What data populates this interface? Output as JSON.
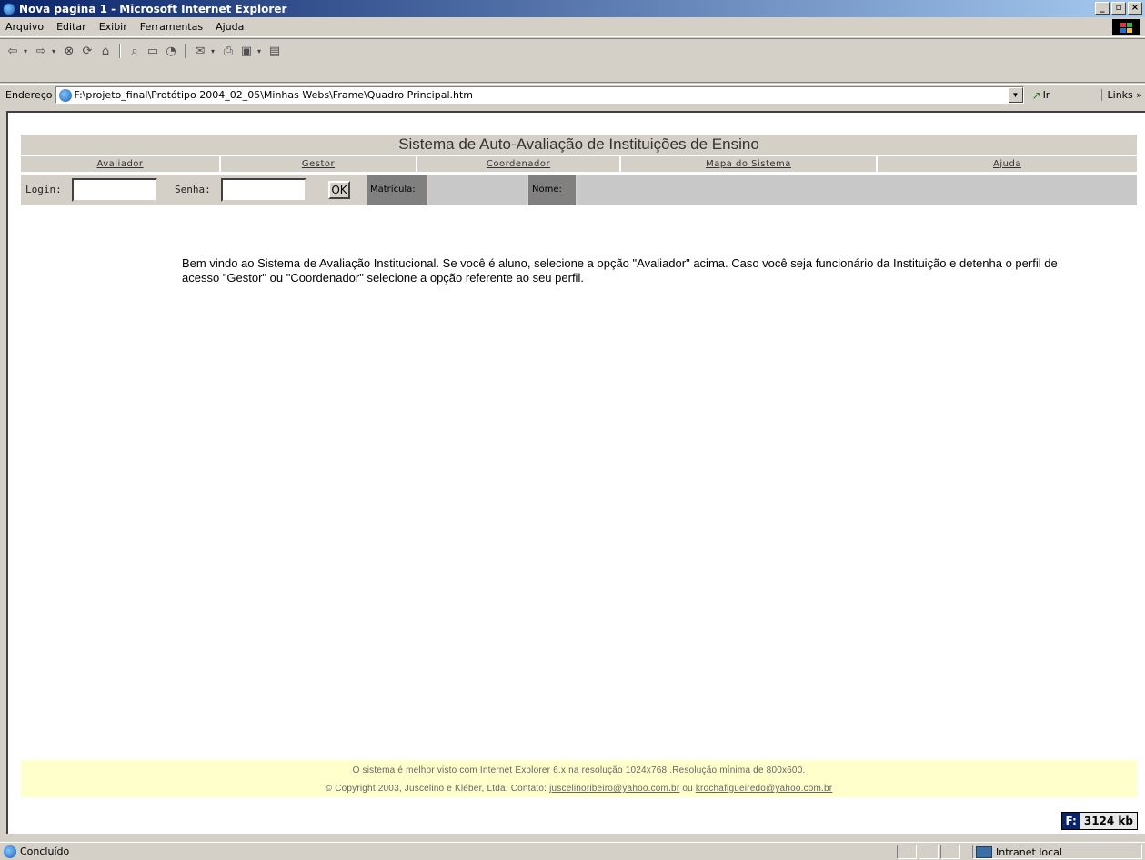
{
  "window": {
    "title": "Nova pagina 1 - Microsoft Internet Explorer",
    "buttons": {
      "minimize": "_",
      "maximize": "▫",
      "close": "×"
    }
  },
  "menubar": {
    "items": [
      "Arquivo",
      "Editar",
      "Exibir",
      "Ferramentas",
      "Ajuda"
    ]
  },
  "toolbar": {
    "icons": [
      "back-icon",
      "forward-icon",
      "stop-icon",
      "refresh-icon",
      "home-icon",
      "search-icon",
      "favorites-icon",
      "history-icon",
      "mail-icon",
      "print-icon",
      "edit-icon",
      "discuss-icon"
    ]
  },
  "address_bar": {
    "label": "Endereço",
    "value": "F:\\projeto_final\\Protótipo 2004_02_05\\Minhas Webs\\Frame\\Quadro Principal.htm",
    "go_label": "Ir",
    "links_label": "Links »"
  },
  "page": {
    "system_title": "Sistema de Auto-Avaliação de Instituições de Ensino",
    "nav": [
      "Avaliador",
      "Gestor",
      "Coordenador",
      "Mapa do Sistema",
      "Ajuda"
    ],
    "login": {
      "login_label": "Login:",
      "login_value": "",
      "senha_label": "Senha:",
      "senha_value": "",
      "ok_label": "OK",
      "matricula_label": "Matrícula:",
      "nome_label": "Nome:"
    },
    "welcome_text": "Bem vindo ao Sistema de Avaliação Institucional. Se você é aluno, selecione a opção \"Avaliador\" acima. Caso você seja funcionário da Instituição e detenha o perfil de acesso \"Gestor\" ou \"Coordenador\" selecione a opção referente ao seu perfil.",
    "footer": {
      "line1": "O sistema é melhor visto com Internet Explorer 6.x na resolução 1024x768 .Resolução mínima de 800x600.",
      "line2_prefix": "© Copyright 2003, Juscelino e Kléber, Ltda. Contato:",
      "email1": "juscelinoribeiro@yahoo.com.br",
      "separator": "ou",
      "email2": "krochafigueiredo@yahoo.com.br"
    },
    "memory_badge": {
      "prefix": "F:",
      "value": "3124 kb"
    }
  },
  "statusbar": {
    "text": "Concluído",
    "zone": "Intranet local"
  }
}
